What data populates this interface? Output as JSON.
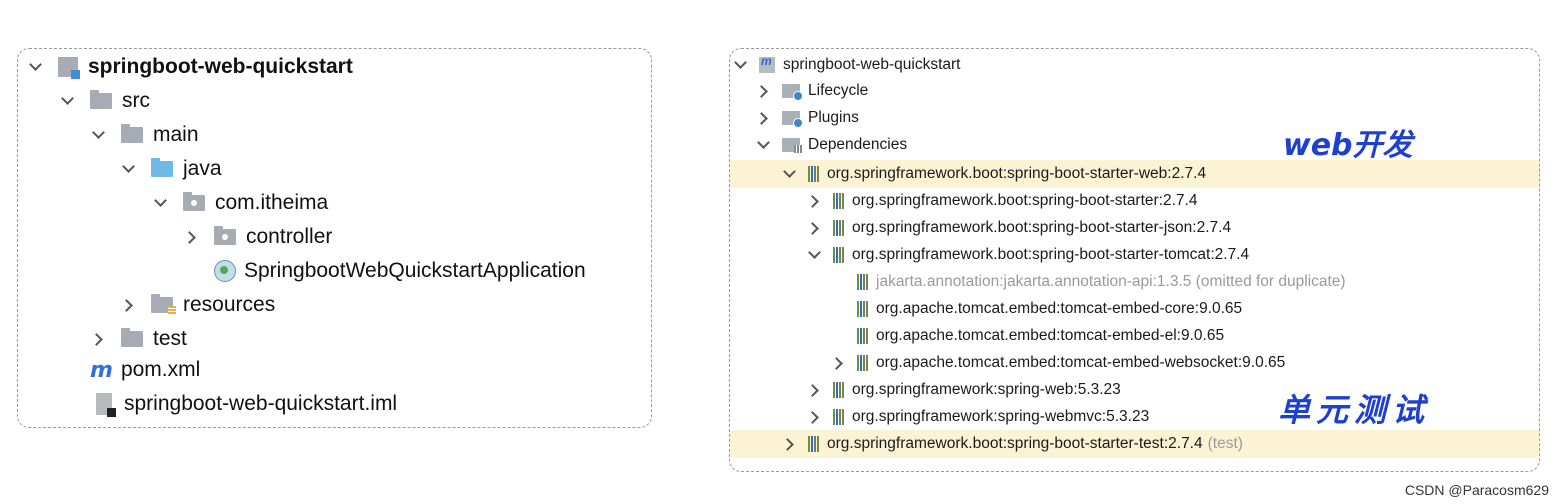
{
  "left_tree": {
    "project": "springboot-web-quickstart",
    "src": "src",
    "main": "main",
    "java": "java",
    "package": "com.itheima",
    "controller": "controller",
    "app_class": "SpringbootWebQuickstartApplication",
    "resources": "resources",
    "test": "test",
    "pom": "pom.xml",
    "iml": "springboot-web-quickstart.iml",
    "maven_icon_glyph": "m"
  },
  "right_tree": {
    "project": "springboot-web-quickstart",
    "lifecycle": "Lifecycle",
    "plugins": "Plugins",
    "dependencies": "Dependencies",
    "deps": [
      "org.springframework.boot:spring-boot-starter-web:2.7.4",
      "org.springframework.boot:spring-boot-starter:2.7.4",
      "org.springframework.boot:spring-boot-starter-json:2.7.4",
      "org.springframework.boot:spring-boot-starter-tomcat:2.7.4",
      "jakarta.annotation:jakarta.annotation-api:1.3.5 (omitted for duplicate)",
      "org.apache.tomcat.embed:tomcat-embed-core:9.0.65",
      "org.apache.tomcat.embed:tomcat-embed-el:9.0.65",
      "org.apache.tomcat.embed:tomcat-embed-websocket:9.0.65",
      "org.springframework:spring-web:5.3.23",
      "org.springframework:spring-webmvc:5.3.23"
    ],
    "test_dep": "org.springframework.boot:spring-boot-starter-test:2.7.4",
    "test_scope": "(test)",
    "highlight_color": "#fcf3d4"
  },
  "annotations": {
    "web_dev": "web开发",
    "unit_test": "单元测试",
    "color": "#1f3fcf"
  },
  "watermark": "CSDN @Paracosm629"
}
